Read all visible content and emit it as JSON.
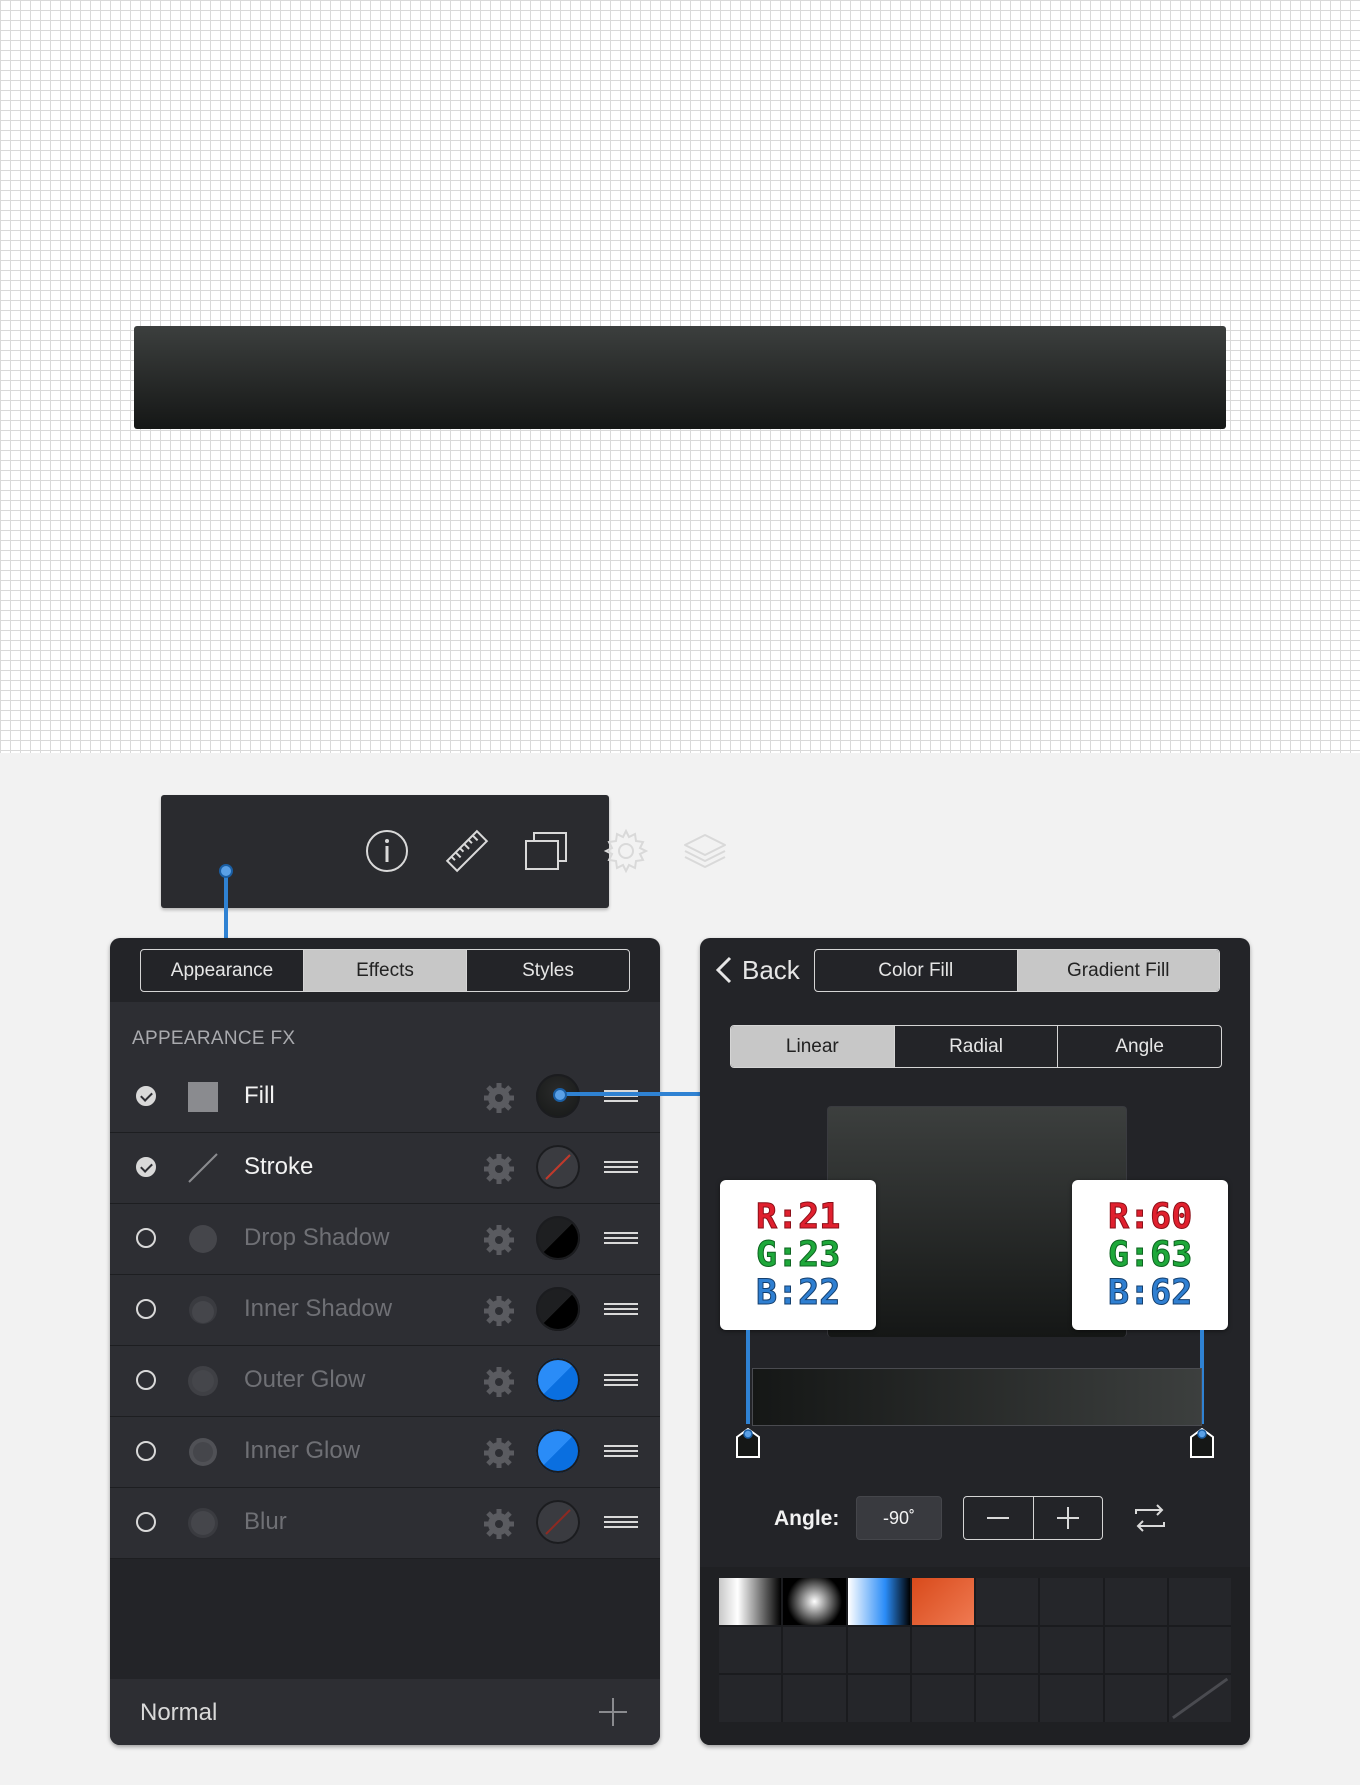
{
  "toolbar": {
    "tools": [
      {
        "name": "info-icon"
      },
      {
        "name": "ruler-icon"
      },
      {
        "name": "artboards-icon"
      },
      {
        "name": "gear-icon"
      },
      {
        "name": "layers-icon"
      }
    ]
  },
  "left_panel": {
    "tabs": [
      {
        "label": "Appearance",
        "active": false
      },
      {
        "label": "Effects",
        "active": true
      },
      {
        "label": "Styles",
        "active": false
      }
    ],
    "section_label": "APPEARANCE FX",
    "effects": [
      {
        "label": "Fill",
        "enabled": true,
        "swatch": "#151716"
      },
      {
        "label": "Stroke",
        "enabled": true,
        "swatch": "none"
      },
      {
        "label": "Drop Shadow",
        "enabled": false,
        "swatch": "#000000"
      },
      {
        "label": "Inner Shadow",
        "enabled": false,
        "swatch": "#000000"
      },
      {
        "label": "Outer Glow",
        "enabled": false,
        "swatch": "#0a7bf5"
      },
      {
        "label": "Inner Glow",
        "enabled": false,
        "swatch": "#0a7bf5"
      },
      {
        "label": "Blur",
        "enabled": false,
        "swatch": "none"
      }
    ],
    "blend_mode": "Normal"
  },
  "right_panel": {
    "back_label": "Back",
    "fill_tabs": [
      {
        "label": "Color Fill",
        "active": false
      },
      {
        "label": "Gradient Fill",
        "active": true
      }
    ],
    "type_tabs": [
      {
        "label": "Linear",
        "active": true
      },
      {
        "label": "Radial",
        "active": false
      },
      {
        "label": "Angle",
        "active": false
      }
    ],
    "stops": [
      {
        "r": "R:21",
        "g": "G:23",
        "b": "B:22",
        "color": "#151716"
      },
      {
        "r": "R:60",
        "g": "G:63",
        "b": "B:62",
        "color": "#3c3f3e"
      }
    ],
    "angle_label": "Angle:",
    "angle_value": "-90˚",
    "presets": [
      "gray-white-black",
      "radial-white-black",
      "blue-white",
      "orange-red"
    ]
  },
  "colors": {
    "accent": "#2f82d3",
    "panel_bg": "#232428",
    "row_bg": "#2d2e33"
  }
}
